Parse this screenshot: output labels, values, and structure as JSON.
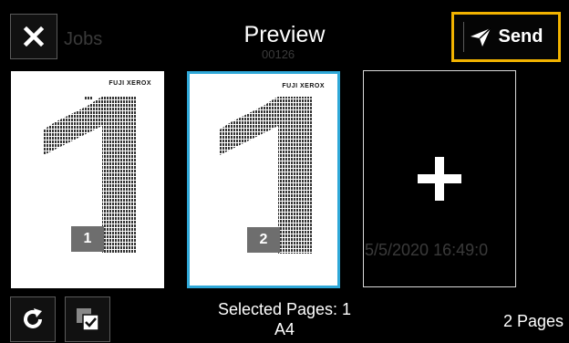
{
  "header": {
    "title": "Preview",
    "send_label": "Send",
    "close_icon": "close-icon",
    "send_icon": "paper-plane-icon"
  },
  "background_ghost": {
    "jobs_label": "Jobs",
    "job_number": "00126",
    "datetime": "5/5/2020 16:49:0"
  },
  "pages": [
    {
      "number": "1",
      "brand": "FUJI XEROX",
      "digit": "1",
      "selected": false
    },
    {
      "number": "2",
      "brand": "FUJI XEROX",
      "digit": "1",
      "selected": true
    }
  ],
  "add_page": {
    "icon": "plus-icon"
  },
  "footer": {
    "selected_label": "Selected Pages: 1",
    "paper_size": "A4",
    "page_count": "2 Pages",
    "rotate_icon": "rotate-icon",
    "select_all_icon": "select-pages-icon"
  },
  "colors": {
    "highlight": "#f2b300",
    "selected_border": "#2fa8d8",
    "background": "#000000"
  }
}
